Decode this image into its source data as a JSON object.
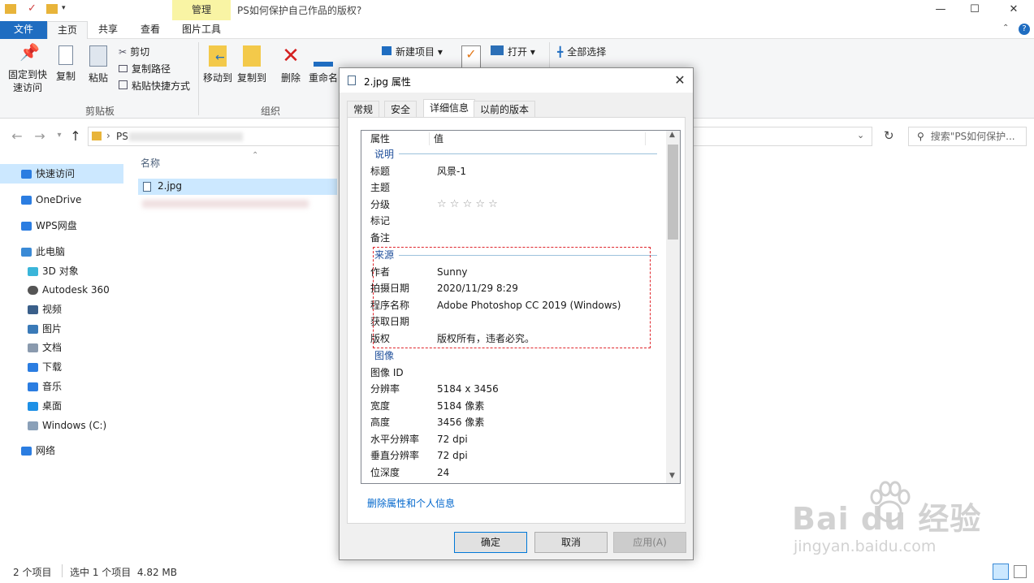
{
  "titlebar": {
    "manage_tab": "管理",
    "window_title": "PS如何保护自己作品的版权?",
    "minimize": "—",
    "maximize": "☐",
    "close": "✕"
  },
  "ribbon_tabs": [
    "文件",
    "主页",
    "共享",
    "查看",
    "图片工具"
  ],
  "ribbon": {
    "pin_label": "固定到快\n速访问",
    "copy_label": "复制",
    "paste_label": "粘贴",
    "cut_label": "剪切",
    "copy_path_label": "复制路径",
    "paste_shortcut_label": "粘贴快捷方式",
    "clipboard_group": "剪贴板",
    "move_to_label": "移动到",
    "copy_to_label": "复制到",
    "delete_label": "删除",
    "rename_label": "重命名",
    "organize_group": "组织",
    "new_item_label": "新建项目",
    "open_label": "打开",
    "select_all_label": "全部选择"
  },
  "address": {
    "path_prefix": "PS",
    "search_placeholder": "搜索\"PS如何保护..."
  },
  "nav": {
    "items": [
      {
        "label": "快速访问",
        "color": "#2b7de1"
      },
      {
        "label": "OneDrive",
        "color": "#2b7de1"
      },
      {
        "label": "WPS网盘",
        "color": "#2b7de1"
      },
      {
        "label": "此电脑",
        "color": "#3a8ad6"
      },
      {
        "label": "3D 对象",
        "color": "#3ab5d9"
      },
      {
        "label": "Autodesk 360",
        "color": "#555555"
      },
      {
        "label": "视频",
        "color": "#3a5f8a"
      },
      {
        "label": "图片",
        "color": "#3a7ab8"
      },
      {
        "label": "文档",
        "color": "#8a9aae"
      },
      {
        "label": "下载",
        "color": "#2b7de1"
      },
      {
        "label": "音乐",
        "color": "#2b7de1"
      },
      {
        "label": "桌面",
        "color": "#1e90e6"
      },
      {
        "label": "Windows (C:)",
        "color": "#8aa0b8"
      },
      {
        "label": "网络",
        "color": "#2b7de1"
      }
    ]
  },
  "filelist": {
    "column_name": "名称",
    "selected_file": "2.jpg"
  },
  "status": {
    "item_count": "2 个项目",
    "selected": "选中 1 个项目  4.82 MB"
  },
  "dialog": {
    "title": "2.jpg 属性",
    "tabs": [
      "常规",
      "安全",
      "详细信息",
      "以前的版本"
    ],
    "header_property": "属性",
    "header_value": "值",
    "sections": {
      "description": "说明",
      "origin": "来源",
      "image": "图像"
    },
    "description_rows": [
      {
        "key": "标题",
        "value": "风景-1"
      },
      {
        "key": "主题",
        "value": ""
      },
      {
        "key": "分级",
        "value": "☆ ☆ ☆ ☆ ☆"
      },
      {
        "key": "标记",
        "value": ""
      },
      {
        "key": "备注",
        "value": ""
      }
    ],
    "origin_rows": [
      {
        "key": "作者",
        "value": "Sunny"
      },
      {
        "key": "拍摄日期",
        "value": "2020/11/29 8:29"
      },
      {
        "key": "程序名称",
        "value": "Adobe Photoshop CC 2019 (Windows)"
      },
      {
        "key": "获取日期",
        "value": ""
      },
      {
        "key": "版权",
        "value": "版权所有，违者必究。"
      }
    ],
    "image_rows": [
      {
        "key": "图像 ID",
        "value": ""
      },
      {
        "key": "分辨率",
        "value": "5184 x 3456"
      },
      {
        "key": "宽度",
        "value": "5184 像素"
      },
      {
        "key": "高度",
        "value": "3456 像素"
      },
      {
        "key": "水平分辨率",
        "value": "72 dpi"
      },
      {
        "key": "垂直分辨率",
        "value": "72 dpi"
      },
      {
        "key": "位深度",
        "value": "24"
      }
    ],
    "remove_link": "删除属性和个人信息",
    "ok": "确定",
    "cancel": "取消",
    "apply": "应用(A)"
  },
  "watermark": {
    "brand": "Bai du 经验",
    "url": "jingyan.baidu.com"
  }
}
